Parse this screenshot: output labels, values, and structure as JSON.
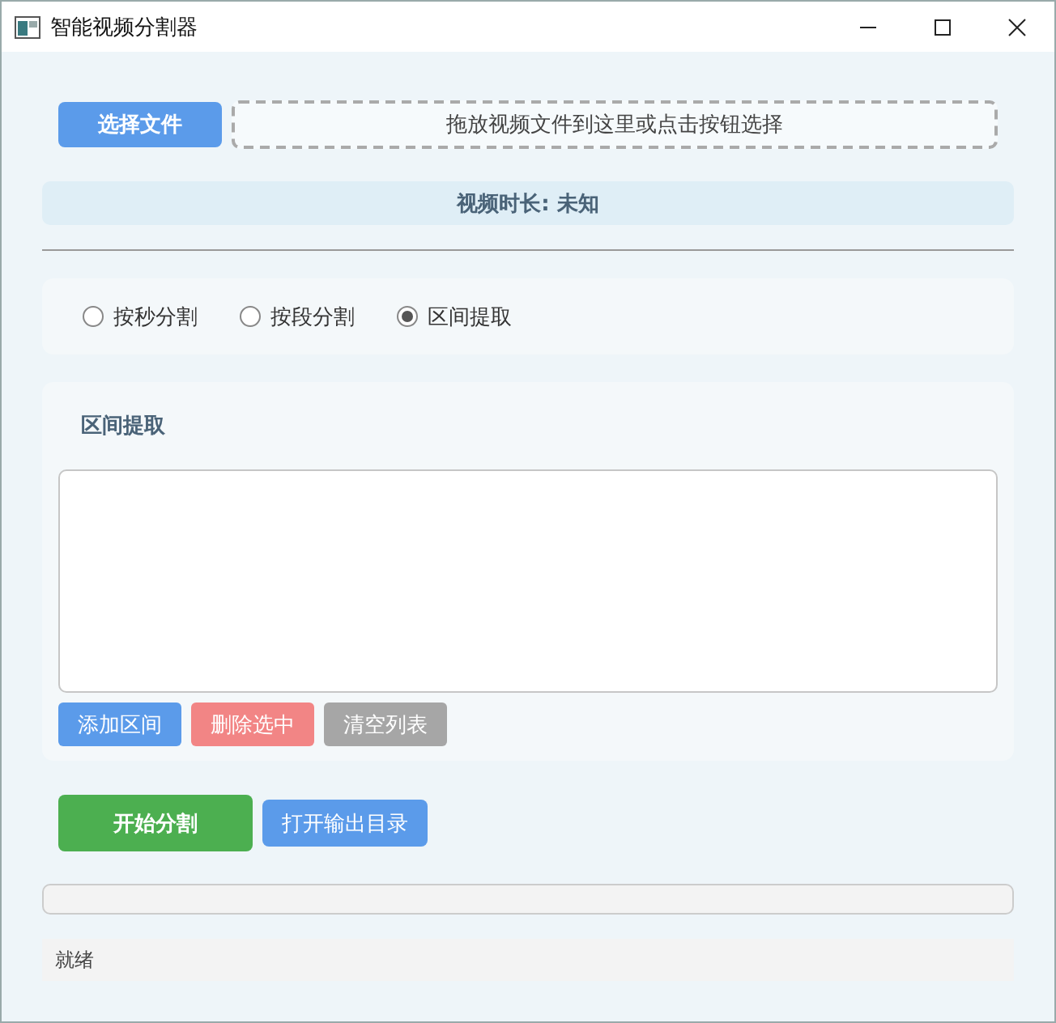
{
  "window": {
    "title": "智能视频分割器"
  },
  "file_picker": {
    "button": "选择文件",
    "drop_zone": "拖放视频文件到这里或点击按钮选择"
  },
  "duration": "视频时长: 未知",
  "modes": [
    {
      "label": "按秒分割",
      "selected": false
    },
    {
      "label": "按段分割",
      "selected": false
    },
    {
      "label": "区间提取",
      "selected": true
    }
  ],
  "section": {
    "title": "区间提取",
    "list_buttons": [
      {
        "label": "添加区间",
        "kind": "primary"
      },
      {
        "label": "删除选中",
        "kind": "danger"
      },
      {
        "label": "清空列表",
        "kind": "neutral"
      }
    ]
  },
  "actions": [
    {
      "label": "开始分割",
      "kind": "success"
    },
    {
      "label": "打开输出目录",
      "kind": "primary"
    }
  ],
  "progress": {
    "level": 0
  },
  "status_bar": "就绪"
}
